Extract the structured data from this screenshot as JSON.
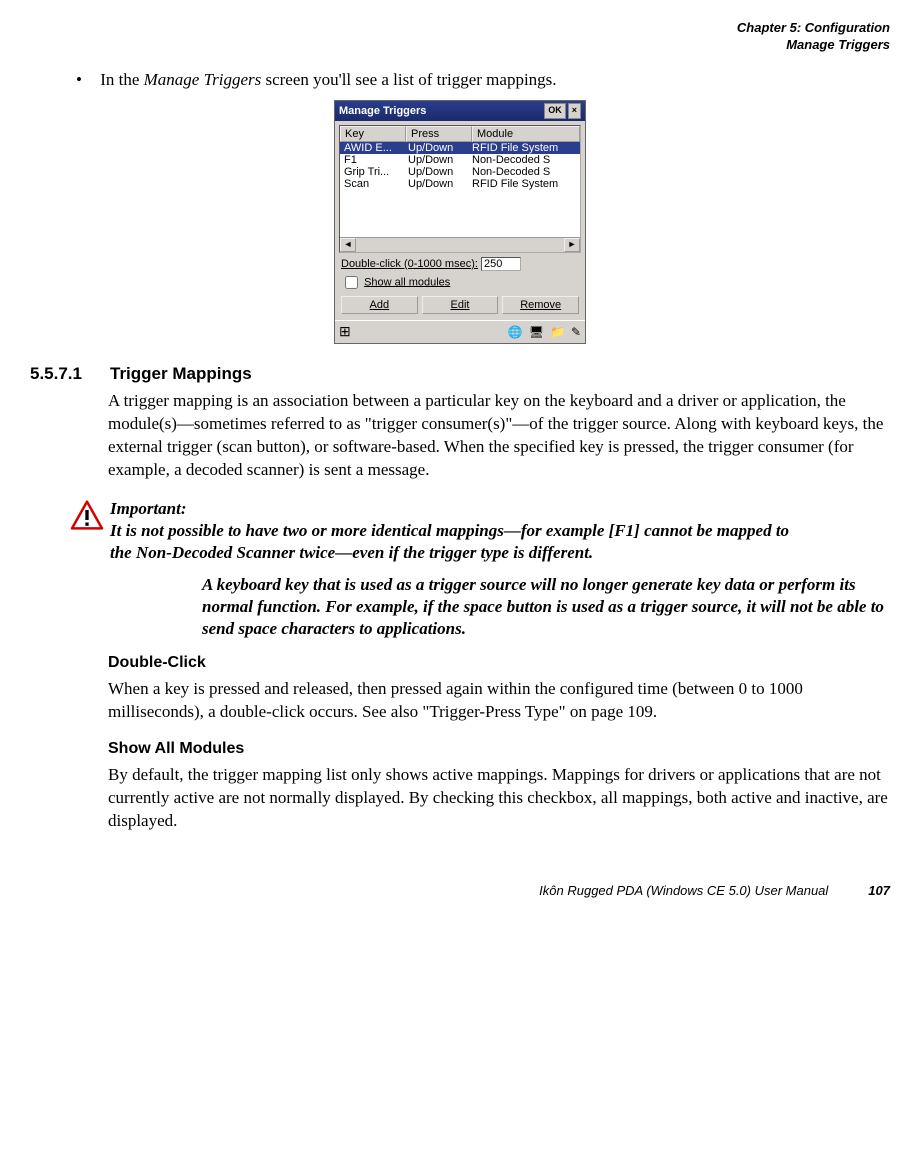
{
  "header": {
    "chapter": "Chapter 5: Configuration",
    "section": "Manage Triggers"
  },
  "bullet_intro_pre": "In the ",
  "bullet_intro_em": "Manage Triggers",
  "bullet_intro_post": " screen you'll see a list of trigger mappings.",
  "screenshot": {
    "title": "Manage Triggers",
    "ok": "OK",
    "close": "×",
    "cols": {
      "key": "Key",
      "press": "Press",
      "module": "Module"
    },
    "rows": [
      {
        "key": "AWID E...",
        "press": "Up/Down",
        "module": "RFID File System"
      },
      {
        "key": "F1",
        "press": "Up/Down",
        "module": "Non-Decoded S"
      },
      {
        "key": "Grip Tri...",
        "press": "Up/Down",
        "module": "Non-Decoded S"
      },
      {
        "key": "Scan",
        "press": "Up/Down",
        "module": "RFID File System"
      }
    ],
    "dbl_label": "Double-click (0-1000 msec):",
    "dbl_value": "250",
    "show_all": "Show all modules",
    "add": "Add",
    "edit": "Edit",
    "remove": "Remove"
  },
  "sec_num": "5.5.7.1",
  "sec_title": "Trigger Mappings",
  "para1": "A trigger mapping is an association between a particular key on the keyboard and a driver or application, the module(s)—sometimes referred to as \"trigger consumer(s)\"—of the trigger source. Along with keyboard keys, the external trigger (scan button), or software-based. When the specified key is pressed, the trigger consumer (for example, a decoded scanner) is sent a message.",
  "important": {
    "label": "Important:",
    "p1": "It is not possible to have two or more identical mappings—for example [F1] cannot be mapped to the Non-Decoded Scanner twice—even if the trigger type is different.",
    "p2": "A keyboard key that is used as a trigger source will no longer generate key data or perform its normal function. For example, if the space button is used as a trigger source, it will not be able to send space characters to applications."
  },
  "sub1": "Double-Click",
  "sub1_body": "When a key is pressed and released, then pressed again within the configured time (between 0 to 1000 milliseconds), a double-click occurs. See also \"Trigger-Press Type\" on page 109.",
  "sub2": "Show All Modules",
  "sub2_body": "By default, the trigger mapping list only shows active mappings. Mappings for drivers or applications that are not currently active are not normally displayed. By checking this checkbox, all mappings, both active and inactive, are displayed.",
  "footer": {
    "title": "Ikôn Rugged PDA (Windows CE 5.0) User Manual",
    "page": "107"
  }
}
